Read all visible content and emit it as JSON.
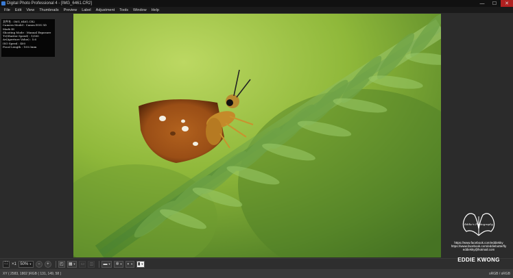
{
  "window": {
    "title": "Digital Photo Professional 4 - [IMG_6461.CR2]",
    "controls": {
      "minimize": "—",
      "maximize": "☐",
      "close": "✕"
    }
  },
  "menu": [
    "File",
    "Edit",
    "View",
    "Thumbnails",
    "Preview",
    "Label",
    "Adjustment",
    "Tools",
    "Window",
    "Help"
  ],
  "info_overlay": {
    "lines": [
      "文件名 : IMG_6461.CR2",
      "Camera Model : Canon EOS 5D Mark III",
      "Shooting Mode : Manual Exposure",
      "Tv(Shutter Speed) : 1/500",
      "Av(Aperture Value) : 5.6",
      "ISO Speed : 400",
      "Focal Length : 100.0mm"
    ]
  },
  "watermark": {
    "logo_text": "Eddie's Photography",
    "links": [
      "https://www.facebook.com/eddiekky",
      "https://www.facebook.com/eddiebutterfly",
      "eddiekky@hotmail.com"
    ],
    "name": "EDDIE KWONG"
  },
  "toolbar": {
    "zoom_x1": "×1",
    "zoom_level": "50%",
    "zoom_out": "−",
    "zoom_in": "+"
  },
  "status": {
    "left": "XY ( 2583, 1802 )RGB ( 131, 149,  58 )",
    "right": "sRGB / sRGB"
  },
  "colors": {
    "bg": "#2b2b2b",
    "title_bar": "#111111",
    "menu_bar": "#1a1a1a",
    "close_button": "#b02020",
    "status_bar": "#3a3a3a"
  }
}
